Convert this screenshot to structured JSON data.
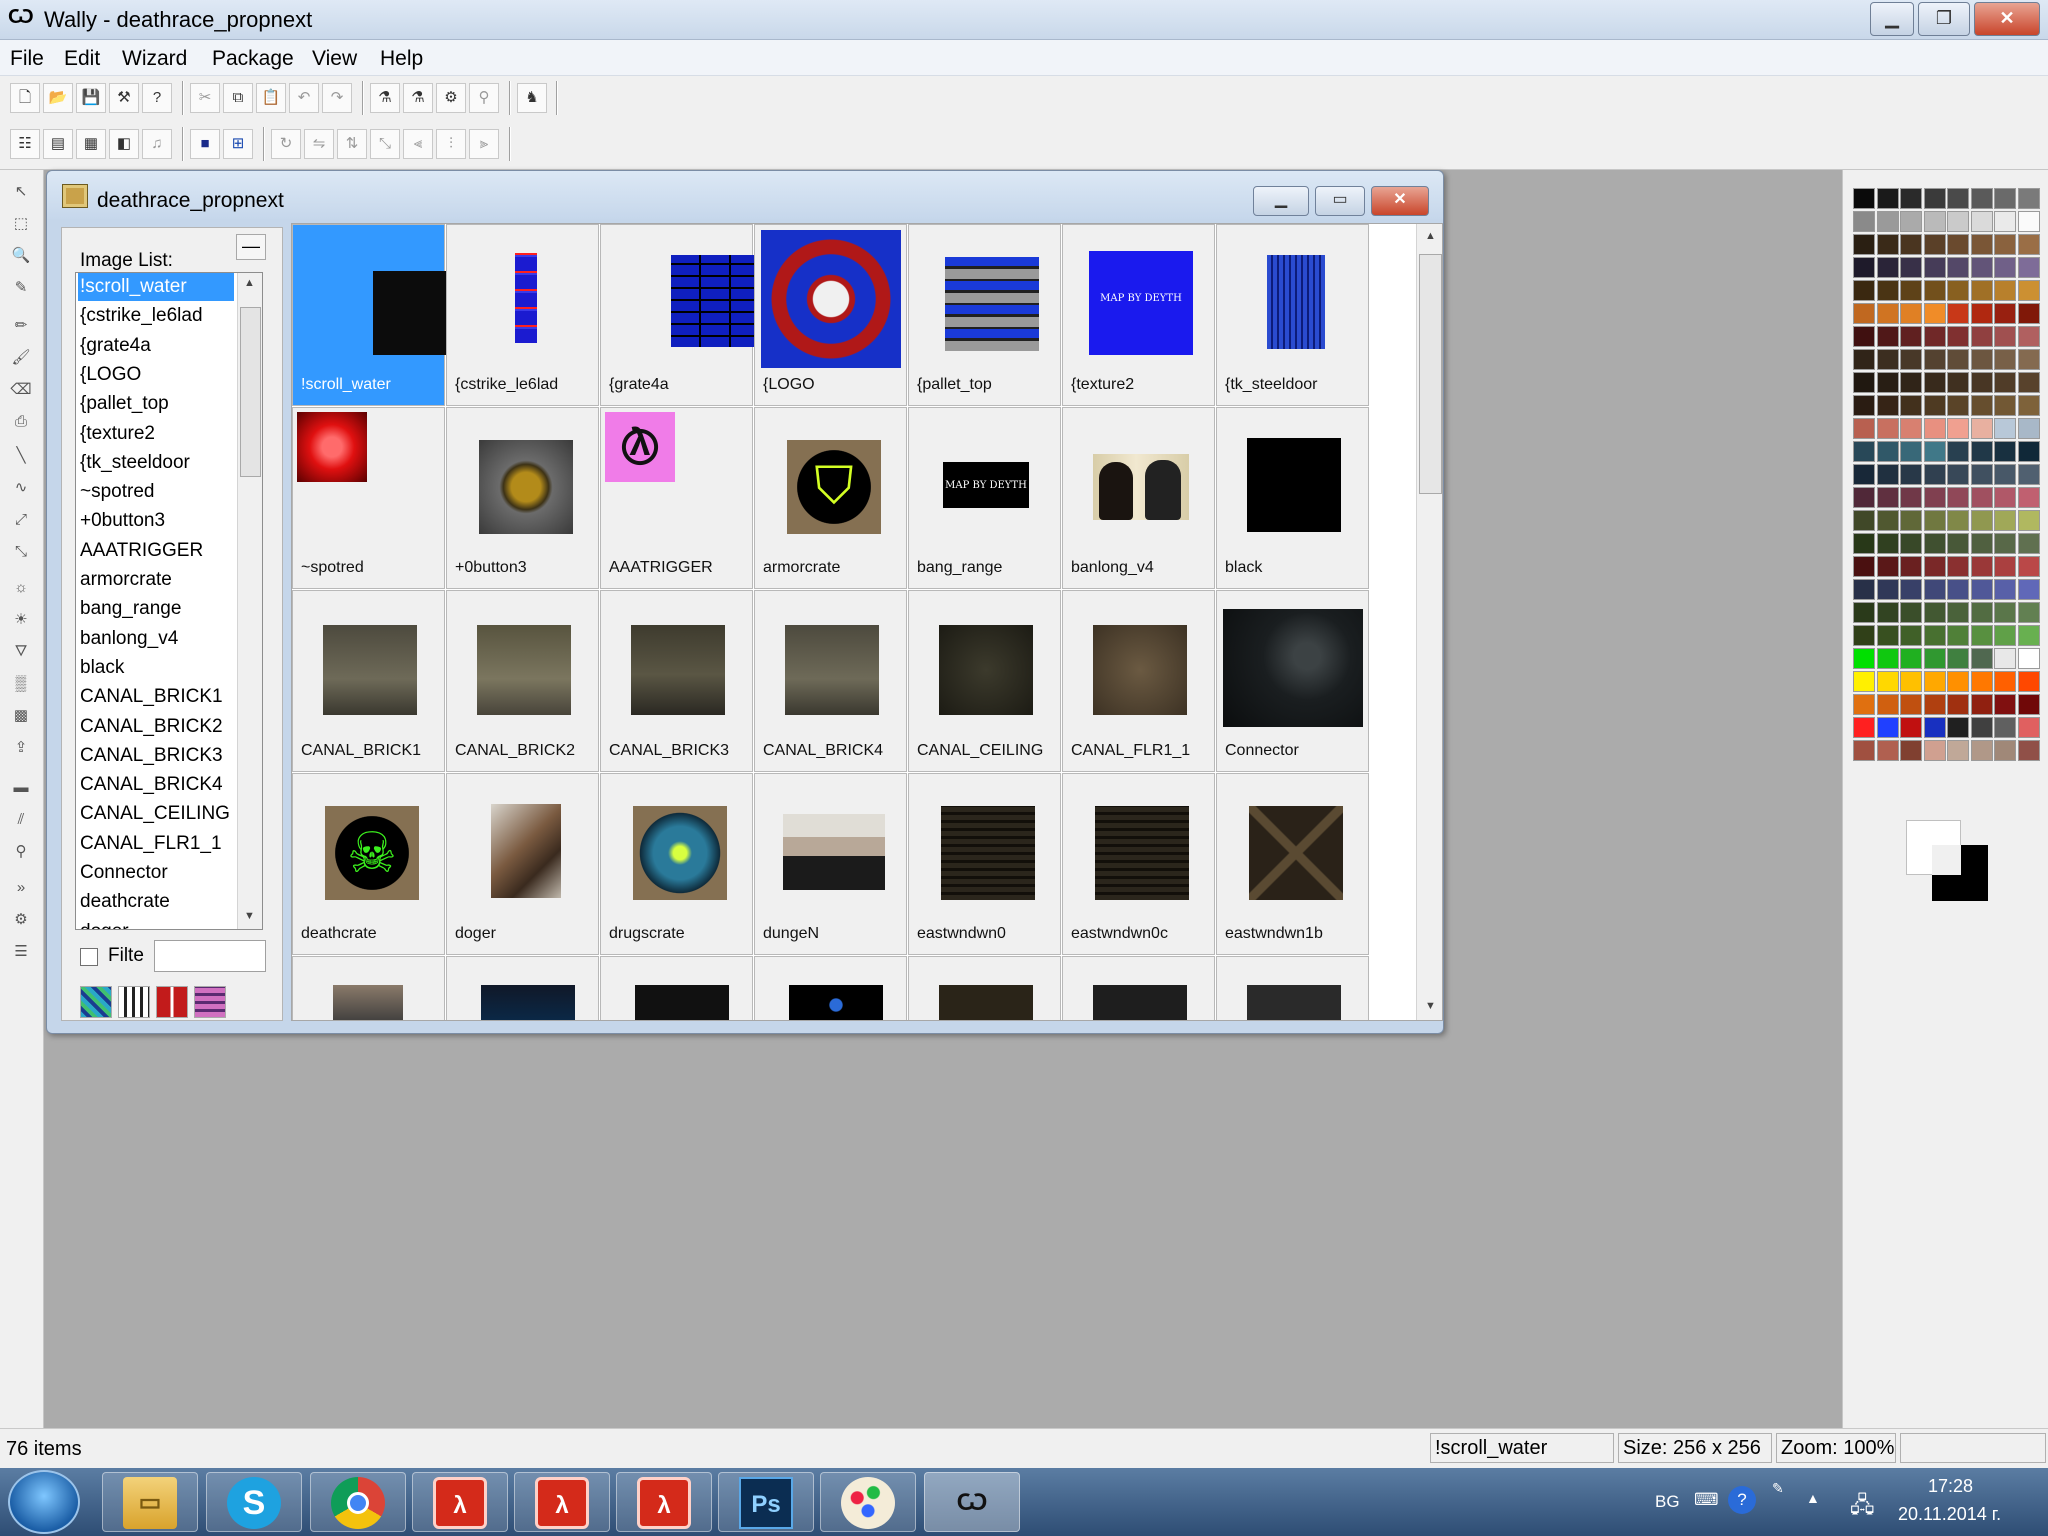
{
  "app": {
    "title": "Wally - deathrace_propnext"
  },
  "menu": [
    "File",
    "Edit",
    "Wizard",
    "Package",
    "View",
    "Help"
  ],
  "document": {
    "title": "deathrace_propnext",
    "list_label": "Image List:",
    "filter_label": "Filte",
    "filter_value": ""
  },
  "image_list": [
    "!scroll_water",
    "{cstrike_le6lad",
    "{grate4a",
    "{LOGO",
    "{pallet_top",
    "{texture2",
    "{tk_steeldoor",
    "~spotred",
    "+0button3",
    "AAATRIGGER",
    "armorcrate",
    "bang_range",
    "banlong_v4",
    "black",
    "CANAL_BRICK1",
    "CANAL_BRICK2",
    "CANAL_BRICK3",
    "CANAL_BRICK4",
    "CANAL_CEILING",
    "CANAL_FLR1_1",
    "Connector",
    "deathcrate",
    "doger"
  ],
  "selected_image": "!scroll_water",
  "thumbnails": [
    {
      "name": "!scroll_water",
      "selected": true
    },
    {
      "name": "{cstrike_le6lad"
    },
    {
      "name": "{grate4a"
    },
    {
      "name": "{LOGO"
    },
    {
      "name": "{pallet_top"
    },
    {
      "name": "{texture2",
      "caption": "MAP BY DEYTH"
    },
    {
      "name": "{tk_steeldoor"
    },
    {
      "name": "~spotred"
    },
    {
      "name": "+0button3"
    },
    {
      "name": "AAATRIGGER"
    },
    {
      "name": "armorcrate"
    },
    {
      "name": "bang_range",
      "caption": "MAP BY DEYTH"
    },
    {
      "name": "banlong_v4"
    },
    {
      "name": "black"
    },
    {
      "name": "CANAL_BRICK1"
    },
    {
      "name": "CANAL_BRICK2"
    },
    {
      "name": "CANAL_BRICK3"
    },
    {
      "name": "CANAL_BRICK4"
    },
    {
      "name": "CANAL_CEILING"
    },
    {
      "name": "CANAL_FLR1_1"
    },
    {
      "name": "Connector"
    },
    {
      "name": "deathcrate"
    },
    {
      "name": "doger"
    },
    {
      "name": "drugscrate"
    },
    {
      "name": "dungeN"
    },
    {
      "name": "eastwndwn0"
    },
    {
      "name": "eastwndwn0c"
    },
    {
      "name": "eastwndwn1b"
    },
    {
      "name": ""
    },
    {
      "name": ""
    },
    {
      "name": ""
    },
    {
      "name": ""
    },
    {
      "name": ""
    },
    {
      "name": ""
    },
    {
      "name": ""
    }
  ],
  "status": {
    "count": "76 items",
    "name": "!scroll_water",
    "size": "Size: 256 x 256",
    "zoom": "Zoom: 100%"
  },
  "taskbar": {
    "language": "BG",
    "time": "17:28",
    "date": "20.11.2014 г.",
    "apps": [
      "explorer",
      "skype",
      "chrome",
      "half-life",
      "half-life",
      "half-life",
      "photoshop",
      "paint",
      "wally"
    ]
  },
  "colors": {
    "selection": "#3399ff",
    "workspace": "#ababab",
    "title_gradient_top": "#dfe9f5"
  }
}
